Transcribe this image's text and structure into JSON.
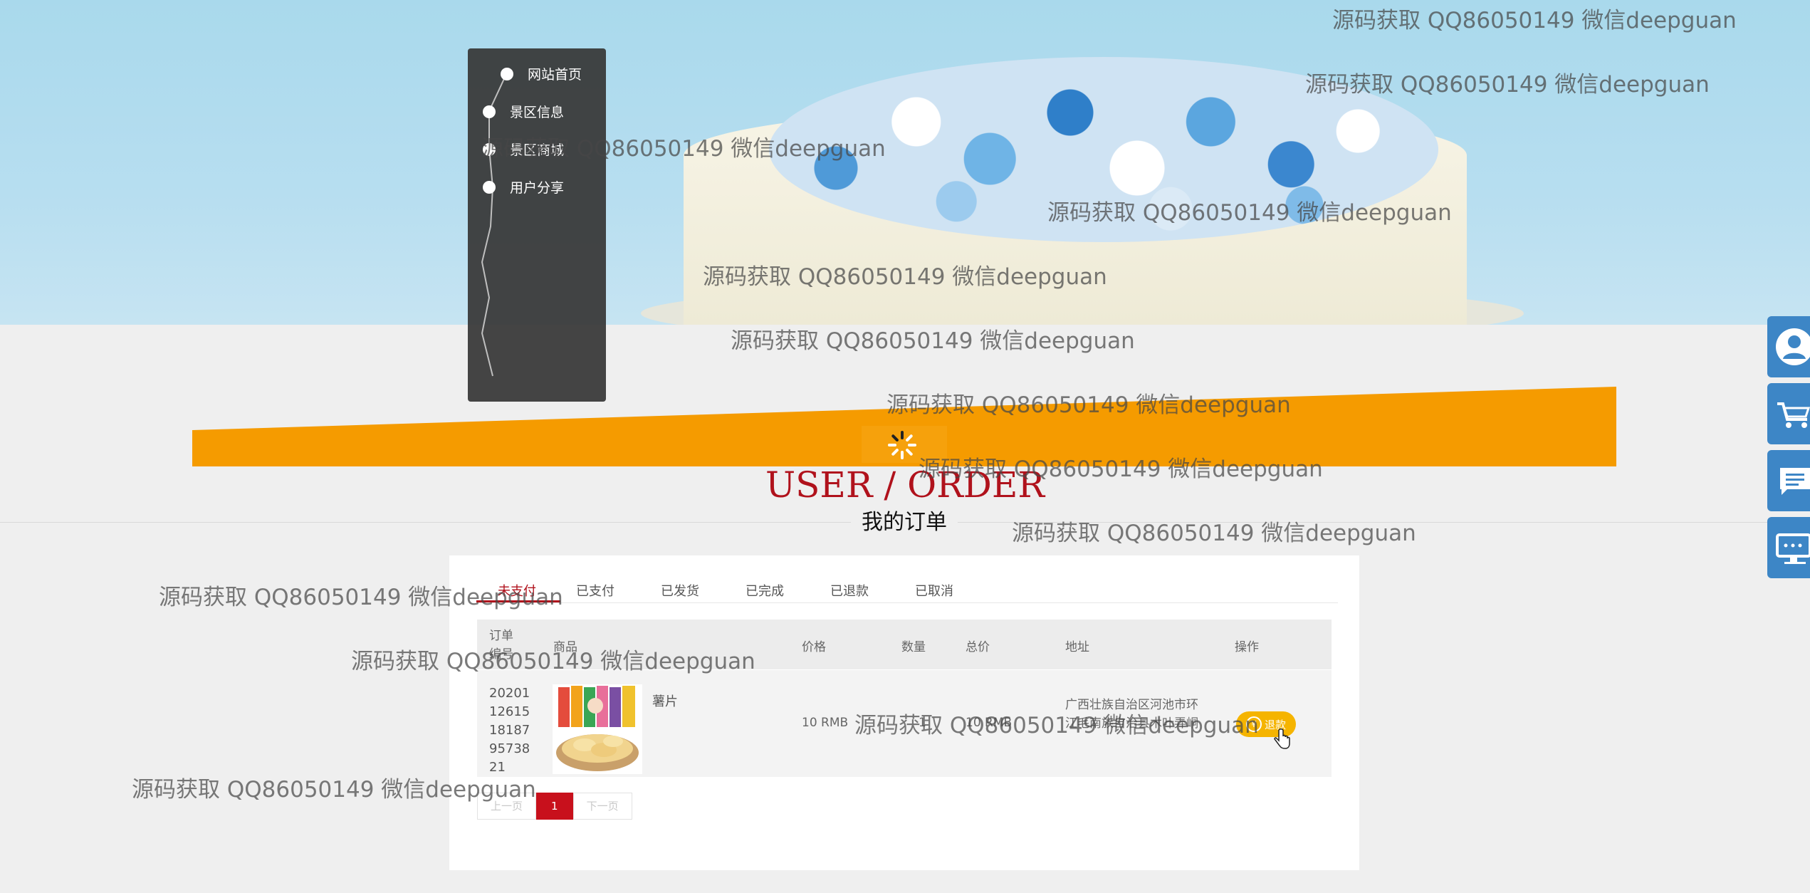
{
  "nav": {
    "items": [
      {
        "label": "网站首页"
      },
      {
        "label": "景区信息"
      },
      {
        "label": "景区商城"
      },
      {
        "label": "用户分享"
      }
    ]
  },
  "page": {
    "title_en": "USER / ORDER",
    "title_cn": "我的订单"
  },
  "tabs": [
    {
      "label": "未支付",
      "active": true
    },
    {
      "label": "已支付"
    },
    {
      "label": "已发货"
    },
    {
      "label": "已完成"
    },
    {
      "label": "已退款"
    },
    {
      "label": "已取消"
    }
  ],
  "table": {
    "headers": [
      "订单编号",
      "商品",
      "价格",
      "数量",
      "总价",
      "地址",
      "操作"
    ],
    "rows": [
      {
        "order_no": "2020112615181879573821",
        "product": "薯片",
        "price": "10 RMB",
        "quantity": "1",
        "total": "10 RMB",
        "address": "广西壮族自治区河池市环江毛南族自治县木叶弄峒",
        "action": "退款"
      }
    ]
  },
  "pager": {
    "prev": "上一页",
    "current": "1",
    "next": "下一页"
  },
  "right_bar": {
    "icons": [
      "user-icon",
      "cart-icon",
      "message-icon",
      "monitor-icon"
    ]
  },
  "watermark": "源码获取 QQ86050149 微信deepguan",
  "colors": {
    "accent": "#b0121c",
    "band": "#f59b00",
    "refund": "#f5b400",
    "float_bar": "#3d86c6"
  }
}
